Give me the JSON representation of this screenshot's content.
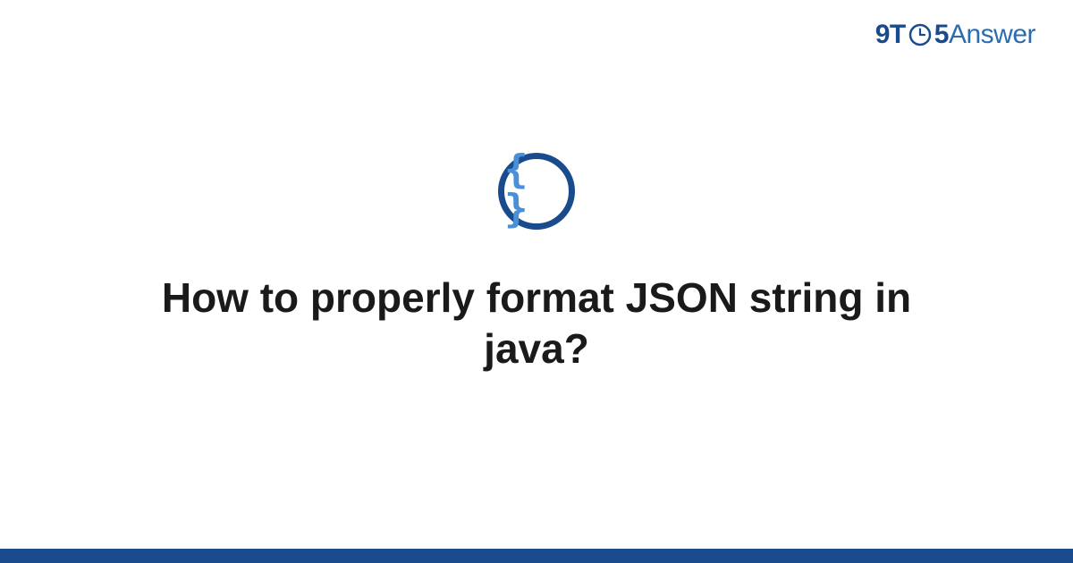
{
  "brand": {
    "part1": "9T",
    "part2": "5",
    "part3": "Answer"
  },
  "icon": {
    "name": "json-braces",
    "glyph": "{ }",
    "ring_color": "#1a4b8c",
    "brace_color": "#4a90d9"
  },
  "title": "How to properly format JSON string in java?",
  "colors": {
    "brand_dark": "#1a4b8c",
    "brand_light": "#2b6cb0",
    "footer": "#1a4b8c",
    "text": "#1a1a1a"
  }
}
